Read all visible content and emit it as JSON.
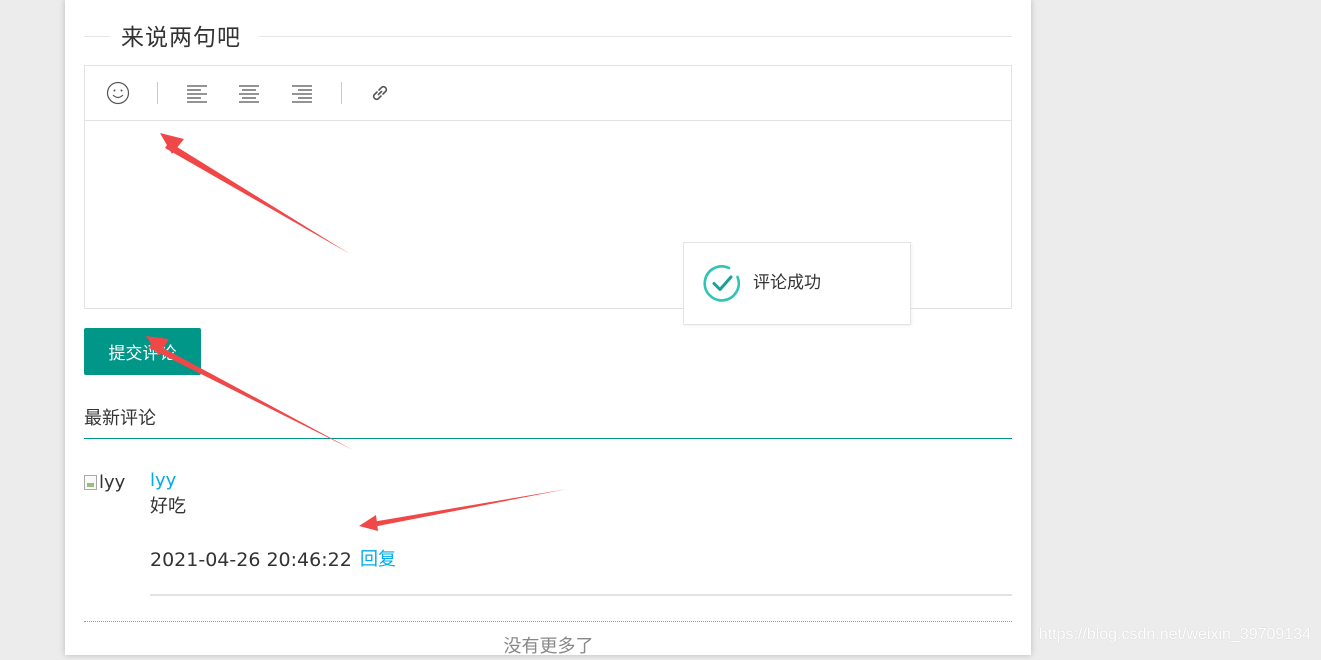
{
  "comment_form": {
    "title": "来说两句吧",
    "toolbar": {
      "items": [
        {
          "name": "emoji-icon"
        },
        {
          "name": "align-left-icon"
        },
        {
          "name": "align-center-icon"
        },
        {
          "name": "align-right-icon"
        },
        {
          "name": "link-icon"
        }
      ]
    },
    "editor_value": "",
    "submit_label": "提交评论"
  },
  "toast": {
    "message": "评论成功",
    "icon": "check-circle-icon",
    "color": "#2ec4b6"
  },
  "latest": {
    "title": "最新评论",
    "accent": "#009688",
    "comments": [
      {
        "avatar_alt": "lyy",
        "user": "lyy",
        "text": "好吃",
        "time": "2021-04-26 20:46:22",
        "reply_label": "回复"
      }
    ],
    "no_more": "没有更多了"
  },
  "watermark": "https://blog.csdn.net/weixin_39709134",
  "colors": {
    "primary": "#009688",
    "link": "#01AAED",
    "annotation_arrow": "#f04848"
  }
}
